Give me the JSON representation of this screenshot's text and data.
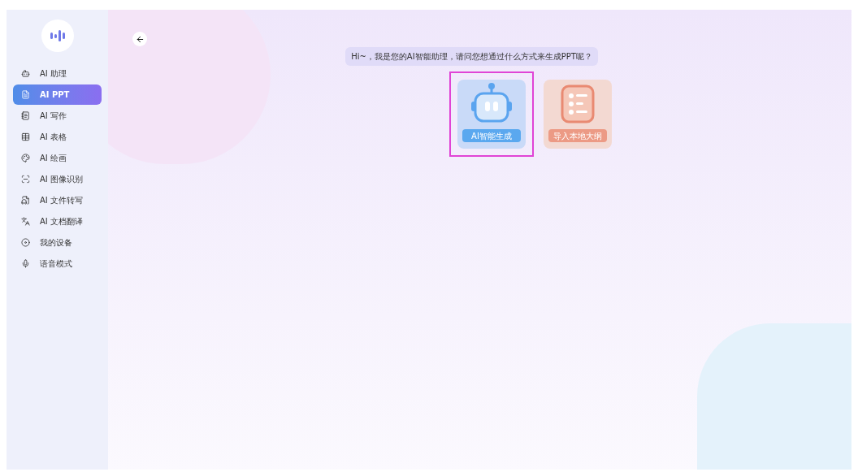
{
  "sidebar": {
    "items": [
      {
        "label": "AI 助理",
        "selected": false
      },
      {
        "label": "AI PPT",
        "selected": true
      },
      {
        "label": "AI 写作",
        "selected": false
      },
      {
        "label": "AI 表格",
        "selected": false
      },
      {
        "label": "AI 绘画",
        "selected": false
      },
      {
        "label": "AI 图像识别",
        "selected": false
      },
      {
        "label": "AI 文件转写",
        "selected": false
      },
      {
        "label": "AI 文档翻译",
        "selected": false
      },
      {
        "label": "我的设备",
        "selected": false
      },
      {
        "label": "语音模式",
        "selected": false
      }
    ]
  },
  "message": "Hi~，我是您的AI智能助理，请问您想通过什么方式来生成PPT呢？",
  "options": [
    {
      "kind": "robot",
      "label": "AI智能生成",
      "selected": true
    },
    {
      "kind": "outline",
      "label": "导入本地大纲",
      "selected": false
    }
  ]
}
